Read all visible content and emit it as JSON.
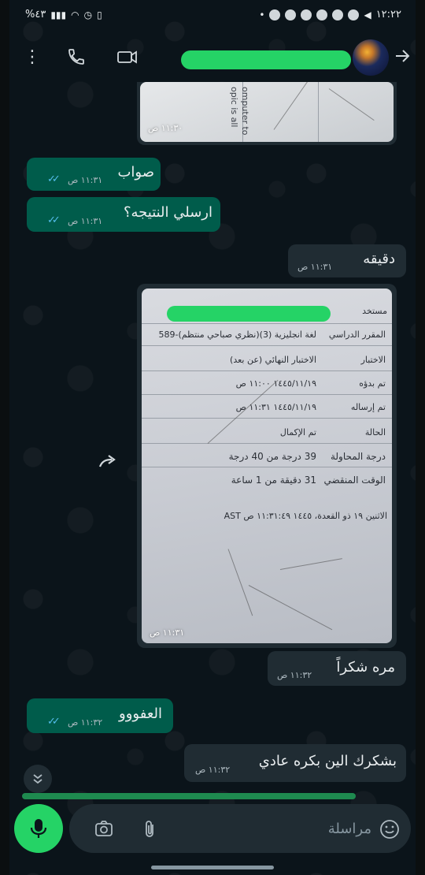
{
  "status_bar": {
    "time": "١٢:٢٢",
    "battery": "%٤٣"
  },
  "chat": {
    "contact_name_redacted": true
  },
  "messages": [
    {
      "id": "m0",
      "type": "image",
      "side": "incoming",
      "time": "١١:٣٠ ص",
      "visible_text": [
        "omputer to",
        "opic is all"
      ]
    },
    {
      "id": "m1",
      "type": "text",
      "side": "outgoing",
      "text": "صواب",
      "time": "١١:٣١ ص",
      "read": true
    },
    {
      "id": "m2",
      "type": "text",
      "side": "outgoing",
      "text": "ارسلي النتيجه؟",
      "time": "١١:٣١ ص",
      "read": true
    },
    {
      "id": "m3",
      "type": "text",
      "side": "incoming",
      "text": "دقيقه",
      "time": "١١:٣١ ص"
    },
    {
      "id": "m4",
      "type": "image",
      "side": "incoming",
      "time": "١١:٣١ ص",
      "photo": {
        "top_label": "مستخد",
        "course_label": "المقرر الدراسي",
        "course_value": "لغة انجليزية (3)(نظري صباحي منتظم)-589",
        "exam_label": "الاختبار",
        "exam_value": "الاختبار النهائي (عن بعد)",
        "started_label": "تم بدؤه",
        "started_value": "١٤٤٥/١١/١٩ ١١:٠٠ ص",
        "submitted_label": "تم إرساله",
        "submitted_value": "١٤٤٥/١١/١٩ ١١:٣١ ص",
        "status_label": "الحالة",
        "status_value": "تم الإكمال",
        "score_label": "درجة المحاولة",
        "score_value": "39 درجة من 40 درجة",
        "elapsed_label": "الوقت المنقضي",
        "elapsed_value": "31 دقيقة من 1 ساعة",
        "timestamp": "الاثنين ١٩ ذو القعدة، ١٤٤٥ ١١:٣١:٤٩ ص AST"
      }
    },
    {
      "id": "m5",
      "type": "text",
      "side": "incoming",
      "text": "مره شكراً",
      "time": "١١:٣٢ ص"
    },
    {
      "id": "m6",
      "type": "text",
      "side": "outgoing",
      "text": "العفووو",
      "time": "١١:٣٢ ص",
      "read": true
    },
    {
      "id": "m7",
      "type": "text",
      "side": "incoming",
      "text": "بشكرك الين بكره عادي",
      "time": "١١:٣٢ ص"
    }
  ],
  "composer": {
    "placeholder": "مراسلة"
  },
  "icons": {
    "menu": "more-vert-icon",
    "call": "phone-icon",
    "video": "video-camera-icon",
    "back": "back-arrow-icon",
    "forward": "forward-icon",
    "scroll_down": "double-chevron-down-icon",
    "camera": "camera-icon",
    "attach": "paperclip-icon",
    "emoji": "emoji-icon",
    "mic": "mic-icon"
  },
  "colors": {
    "background": "#0b141a",
    "outgoing_bubble": "#005c4b",
    "incoming_bubble": "#202c33",
    "accent": "#25d366",
    "read_ticks": "#53bdeb"
  }
}
